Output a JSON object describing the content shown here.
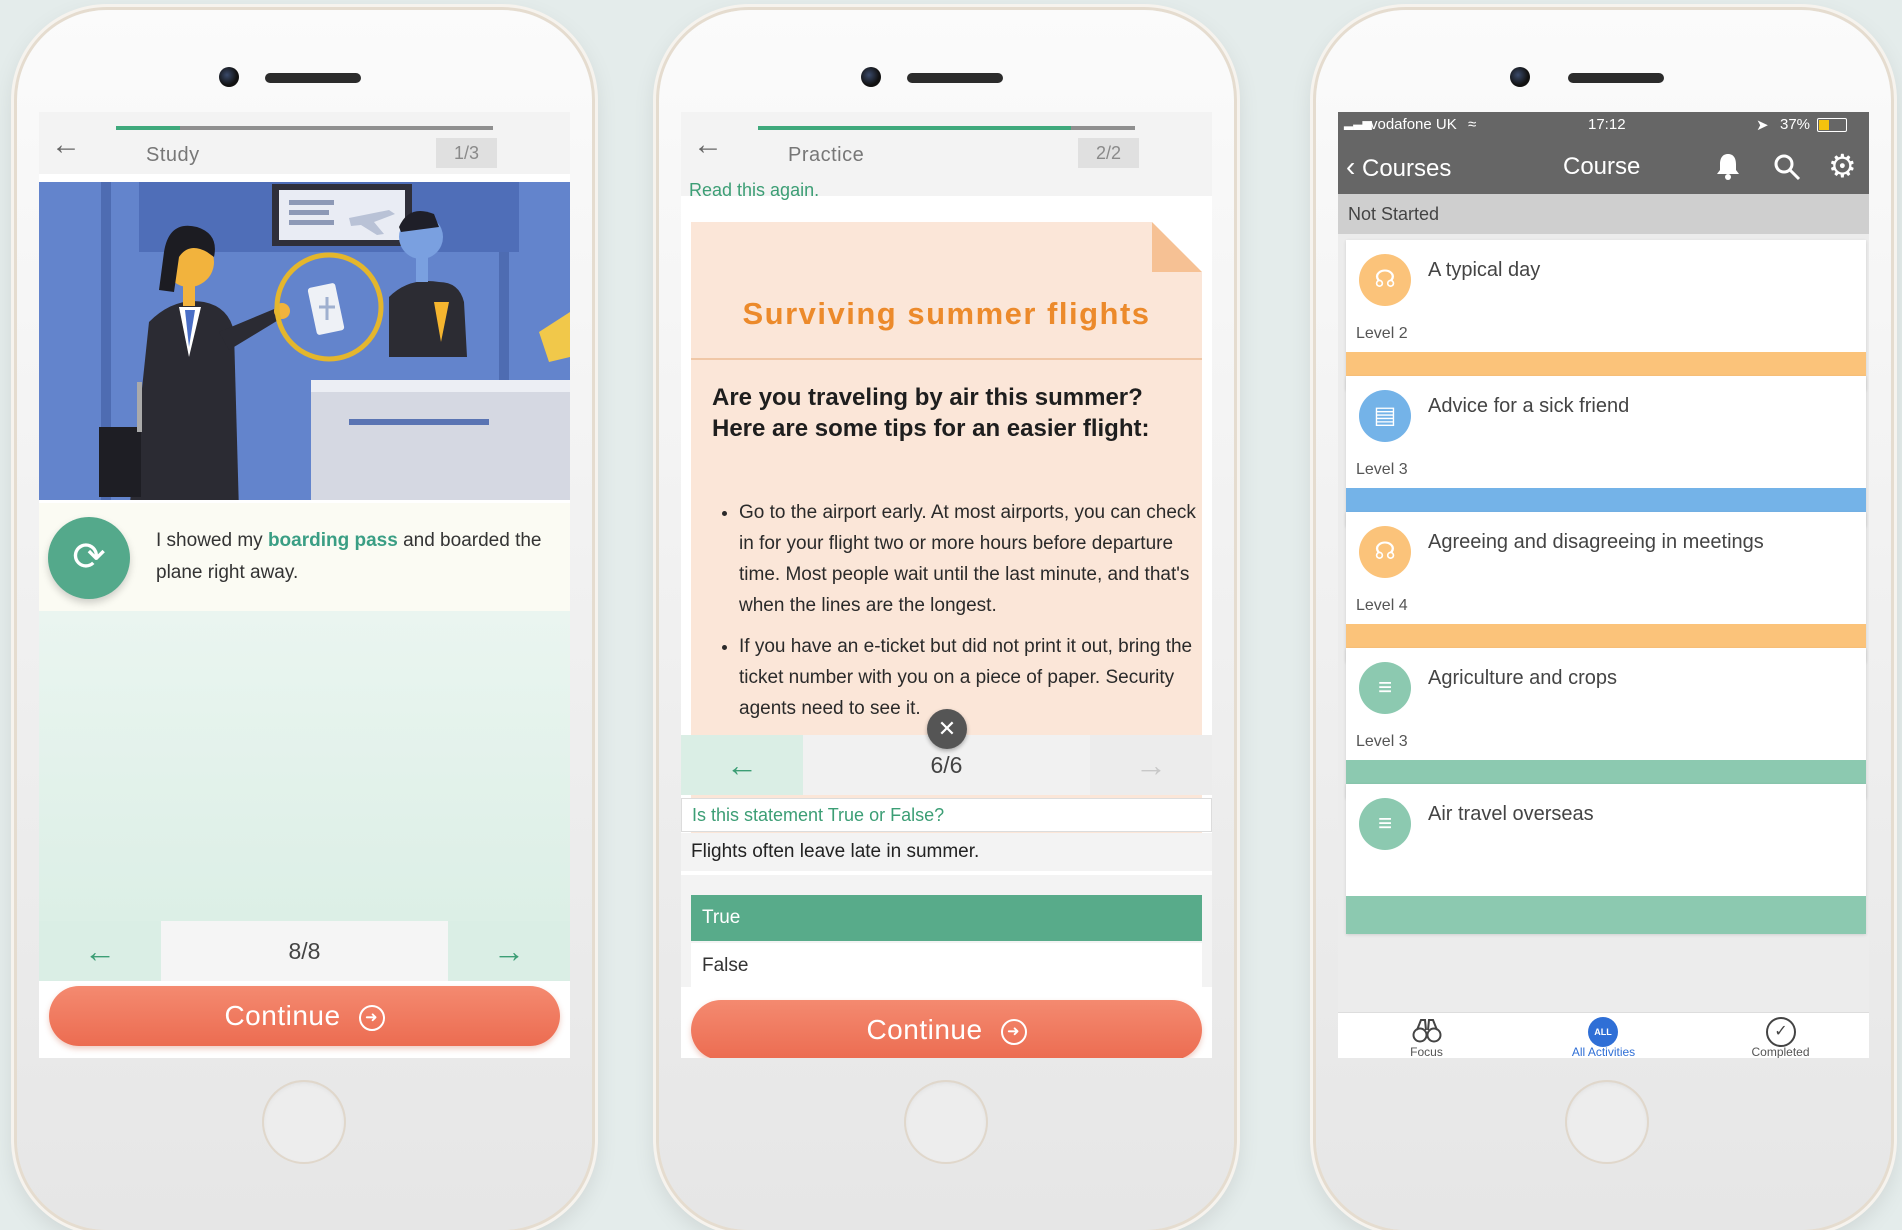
{
  "phone1": {
    "topbar": {
      "title": "Study",
      "counter": "1/3",
      "progress": 0.17
    },
    "caption": {
      "before": "I showed my ",
      "highlight": "boarding pass",
      "after": " and boarded the plane right away."
    },
    "nav": {
      "page": "8/8"
    },
    "continue_label": "Continue"
  },
  "phone2": {
    "topbar": {
      "title": "Practice",
      "counter": "2/2",
      "progress": 0.83
    },
    "hint": "Read this again.",
    "article": {
      "title": "Surviving summer flights",
      "lead": "Are you traveling by air this summer? Here are some tips for an easier flight:",
      "bullets": [
        "Go to the airport early. At most airports, you can check in for your flight two or more hours before departure time. Most people wait until the last minute, and that's when the lines are the longest.",
        "If you have an e-ticket but did not print it out, bring the ticket number with you on a piece of paper. Security agents need to see it."
      ]
    },
    "nav": {
      "page": "6/6"
    },
    "question": {
      "prompt": "Is this statement True or False?",
      "statement": "Flights often leave late in summer.",
      "options": [
        "True",
        "False"
      ],
      "selected": "True"
    },
    "continue_label": "Continue"
  },
  "phone3": {
    "status": {
      "carrier": "vodafone UK",
      "time": "17:12",
      "battery": "37%"
    },
    "navbar": {
      "back_label": "Courses",
      "title": "Course"
    },
    "section_header": "Not Started",
    "courses": [
      {
        "title": "A typical day",
        "level": "Level 2",
        "color": "#fbc37a",
        "icon": "headphones-icon"
      },
      {
        "title": "Advice for a sick friend",
        "level": "Level 3",
        "color": "#74b3e8",
        "icon": "chat-bubble-icon"
      },
      {
        "title": "Agreeing and disagreeing in meetings",
        "level": "Level 4",
        "color": "#fbc37a",
        "icon": "headphones-icon"
      },
      {
        "title": "Agriculture and crops",
        "level": "Level 3",
        "color": "#8cc9b0",
        "icon": "document-icon"
      },
      {
        "title": "Air travel overseas",
        "level": "",
        "color": "#8cc9b0",
        "icon": "document-icon"
      }
    ],
    "tabs": [
      {
        "label": "Focus",
        "active": false
      },
      {
        "label": "All Activities",
        "badge": "ALL",
        "active": true
      },
      {
        "label": "Completed",
        "active": false
      }
    ]
  }
}
